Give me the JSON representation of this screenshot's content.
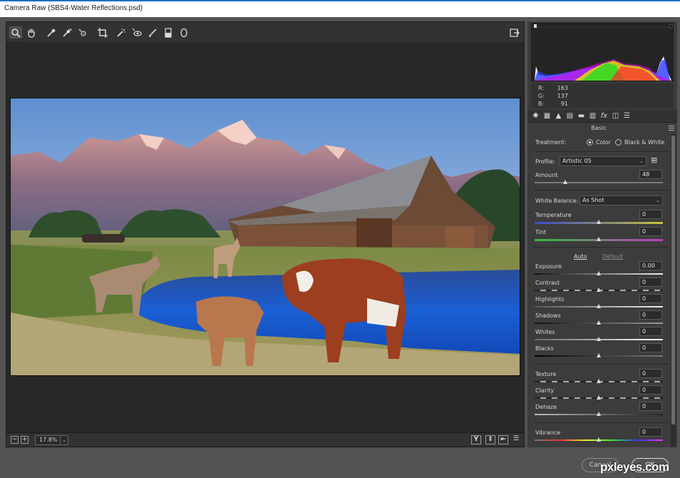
{
  "window": {
    "title": "Camera Raw (SBS4-Water Reflections.psd)"
  },
  "toolbar": {
    "tools": [
      "zoom-tool",
      "hand-tool",
      "white-balance-tool",
      "color-sampler-tool",
      "targeted-adjustment-tool",
      "crop-tool",
      "spot-removal-tool",
      "red-eye-tool",
      "adjustment-brush-tool",
      "graduated-filter-tool",
      "radial-filter-tool"
    ],
    "active_tool": "zoom-tool"
  },
  "status": {
    "zoom": "17.8%"
  },
  "readout": {
    "r_label": "R:",
    "r": "163",
    "g_label": "G:",
    "g": "137",
    "b_label": "B:",
    "b": "91"
  },
  "panel": {
    "title": "Basic",
    "treatment_label": "Treatment:",
    "treatment_color": "Color",
    "treatment_bw": "Black & White",
    "treatment_selected": "Color",
    "profile_label": "Profile:",
    "profile_value": "Artistic 05",
    "amount_label": "Amount",
    "amount_value": "48",
    "wb_label": "White Balance:",
    "wb_value": "As Shot",
    "auto": "Auto",
    "default": "Default",
    "sliders": {
      "temperature": {
        "label": "Temperature",
        "value": "0"
      },
      "tint": {
        "label": "Tint",
        "value": "0"
      },
      "exposure": {
        "label": "Exposure",
        "value": "0.00"
      },
      "contrast": {
        "label": "Contrast",
        "value": "0"
      },
      "highlights": {
        "label": "Highlights",
        "value": "0"
      },
      "shadows": {
        "label": "Shadows",
        "value": "0"
      },
      "whites": {
        "label": "Whites",
        "value": "0"
      },
      "blacks": {
        "label": "Blacks",
        "value": "0"
      },
      "texture": {
        "label": "Texture",
        "value": "0"
      },
      "clarity": {
        "label": "Clarity",
        "value": "0"
      },
      "dehaze": {
        "label": "Dehaze",
        "value": "0"
      },
      "vibrance": {
        "label": "Vibrance",
        "value": "0"
      }
    }
  },
  "footer": {
    "cancel": "Cancel",
    "ok": "OK"
  },
  "watermark": "pxleyes.com",
  "colors": {
    "bg": "#535353",
    "panel": "#3c3c3c",
    "canvas": "#282828"
  }
}
